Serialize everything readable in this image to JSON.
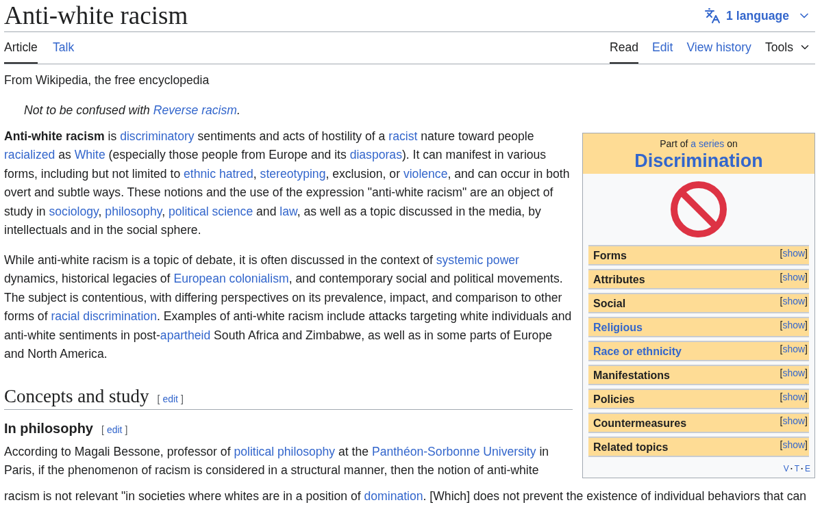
{
  "title": "Anti-white racism",
  "language_button": {
    "label": "1 language"
  },
  "tabs_left": [
    {
      "label": "Article",
      "selected": true
    },
    {
      "label": "Talk",
      "selected": false
    }
  ],
  "tabs_right": [
    {
      "label": "Read",
      "selected": true,
      "kind": "tab"
    },
    {
      "label": "Edit",
      "selected": false,
      "kind": "tab"
    },
    {
      "label": "View history",
      "selected": false,
      "kind": "tab"
    },
    {
      "label": "Tools",
      "selected": false,
      "kind": "menu"
    }
  ],
  "tagline": "From Wikipedia, the free encyclopedia",
  "hatnote": [
    {
      "t": "Not to be confused with ",
      "kind": "plain"
    },
    {
      "t": "Reverse racism",
      "kind": "link"
    },
    {
      "t": ".",
      "kind": "plain"
    }
  ],
  "infobox": {
    "pre": "Part of ",
    "series_link": "a series",
    "post": " on",
    "title": "Discrimination",
    "sections": [
      {
        "label": "Forms",
        "link": false,
        "open": "[",
        "toggle": "show",
        "close": "]"
      },
      {
        "label": "Attributes",
        "link": false,
        "open": "[",
        "toggle": "show",
        "close": "]"
      },
      {
        "label": "Social",
        "link": false,
        "open": "[",
        "toggle": "show",
        "close": "]"
      },
      {
        "label": "Religious",
        "link": true,
        "open": "[",
        "toggle": "show",
        "close": "]"
      },
      {
        "label": "Race or ethnicity",
        "link": true,
        "open": "[",
        "toggle": "show",
        "close": "]"
      },
      {
        "label": "Manifestations",
        "link": false,
        "open": "[",
        "toggle": "show",
        "close": "]"
      },
      {
        "label": "Policies",
        "link": false,
        "open": "[",
        "toggle": "show",
        "close": "]"
      },
      {
        "label": "Countermeasures",
        "link": false,
        "open": "[",
        "toggle": "show",
        "close": "]"
      },
      {
        "label": "Related topics",
        "link": false,
        "open": "[",
        "toggle": "show",
        "close": "]"
      }
    ],
    "navbar": [
      "V",
      "T",
      "E"
    ],
    "navbar_sep": "·"
  },
  "intro": [
    [
      {
        "t": "Anti-white racism",
        "kind": "bold"
      },
      {
        "t": " is ",
        "kind": "plain"
      },
      {
        "t": "discriminatory",
        "kind": "link"
      },
      {
        "t": " sentiments and acts of hostility of a ",
        "kind": "plain"
      },
      {
        "t": "racist",
        "kind": "link"
      },
      {
        "t": " nature toward people ",
        "kind": "plain"
      },
      {
        "t": "racialized",
        "kind": "link"
      },
      {
        "t": " as ",
        "kind": "plain"
      },
      {
        "t": "White",
        "kind": "link"
      },
      {
        "t": " (especially those people from Europe and its ",
        "kind": "plain"
      },
      {
        "t": "diasporas",
        "kind": "link"
      },
      {
        "t": "). It can manifest in various forms, including but not limited to ",
        "kind": "plain"
      },
      {
        "t": "ethnic hatred",
        "kind": "link"
      },
      {
        "t": ", ",
        "kind": "plain"
      },
      {
        "t": "stereotyping",
        "kind": "link"
      },
      {
        "t": ", exclusion, or ",
        "kind": "plain"
      },
      {
        "t": "violence",
        "kind": "link"
      },
      {
        "t": ", and can occur in both overt and subtle ways. These notions and the use of the expression \"anti-white racism\" are an object of study in ",
        "kind": "plain"
      },
      {
        "t": "sociology",
        "kind": "link"
      },
      {
        "t": ", ",
        "kind": "plain"
      },
      {
        "t": "philosophy",
        "kind": "link"
      },
      {
        "t": ", ",
        "kind": "plain"
      },
      {
        "t": "political science",
        "kind": "link"
      },
      {
        "t": " and ",
        "kind": "plain"
      },
      {
        "t": "law",
        "kind": "link"
      },
      {
        "t": ", as well as a topic discussed in the media, by intellectuals and in the social sphere.",
        "kind": "plain"
      }
    ],
    [
      {
        "t": "While anti-white racism is a topic of debate, it is often discussed in the context of ",
        "kind": "plain"
      },
      {
        "t": "systemic power",
        "kind": "link"
      },
      {
        "t": " dynamics, historical legacies of ",
        "kind": "plain"
      },
      {
        "t": "European colonialism",
        "kind": "link"
      },
      {
        "t": ", and contemporary social and political movements. The subject is contentious, with differing perspectives on its prevalence, impact, and comparison to other forms of ",
        "kind": "plain"
      },
      {
        "t": "racial discrimination",
        "kind": "link"
      },
      {
        "t": ". Examples of anti-white racism include attacks targeting white individuals and anti-white sentiments in post-",
        "kind": "plain"
      },
      {
        "t": "apartheid",
        "kind": "link"
      },
      {
        "t": " South Africa and Zimbabwe, as well as in some parts of Europe and North America.",
        "kind": "plain"
      }
    ]
  ],
  "heading": {
    "text": "Concepts and study",
    "edit": {
      "open": "[",
      "label": "edit",
      "close": "]"
    }
  },
  "subheading": {
    "text": "In philosophy",
    "edit": {
      "open": "[",
      "label": "edit",
      "close": "]"
    }
  },
  "body": [
    [
      {
        "t": "According to Magali Bessone, professor of ",
        "kind": "plain"
      },
      {
        "t": "political philosophy",
        "kind": "link"
      },
      {
        "t": " at the ",
        "kind": "plain"
      },
      {
        "t": "Panthéon-Sorbonne University",
        "kind": "link"
      },
      {
        "t": " in Paris, if the phenomenon of racism is considered in a structural manner, then the notion of anti-white",
        "kind": "plain"
      }
    ],
    [
      {
        "t": "racism is not relevant \"in societies where whites are in a position of ",
        "kind": "plain"
      },
      {
        "t": "domination",
        "kind": "link"
      },
      {
        "t": ". [Which] does not prevent the existence of individual behaviors that can",
        "kind": "plain"
      }
    ]
  ]
}
